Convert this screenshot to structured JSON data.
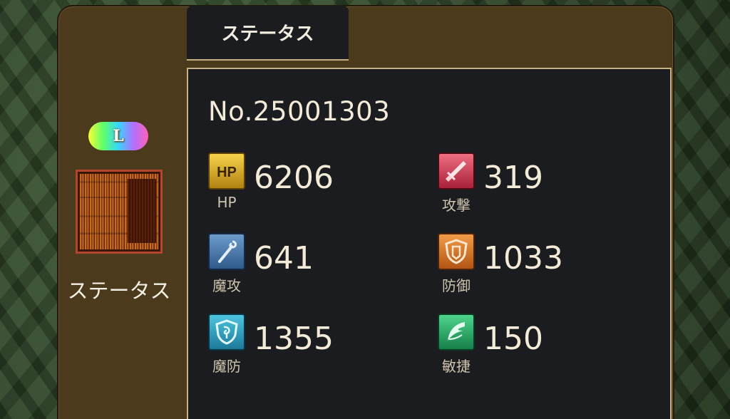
{
  "tab": {
    "label": "ステータス"
  },
  "item": {
    "rarity": "L",
    "name": "ステータス",
    "number": "No.25001303"
  },
  "stats": [
    {
      "key": "hp",
      "label": "HP",
      "value": "6206",
      "icon": "hp-icon",
      "icon_text": "HP",
      "color": "#d6a624"
    },
    {
      "key": "attack",
      "label": "攻撃",
      "value": "319",
      "icon": "sword-icon",
      "color": "#d64058"
    },
    {
      "key": "magic_attack",
      "label": "魔攻",
      "value": "641",
      "icon": "staff-icon",
      "color": "#4a7ab0"
    },
    {
      "key": "defense",
      "label": "防御",
      "value": "1033",
      "icon": "shield-icon",
      "color": "#e07a2a"
    },
    {
      "key": "magic_defense",
      "label": "魔防",
      "value": "1355",
      "icon": "magic-shield-icon",
      "color": "#2ea2c2"
    },
    {
      "key": "agility",
      "label": "敏捷",
      "value": "150",
      "icon": "wing-icon",
      "color": "#2eb06a"
    }
  ]
}
